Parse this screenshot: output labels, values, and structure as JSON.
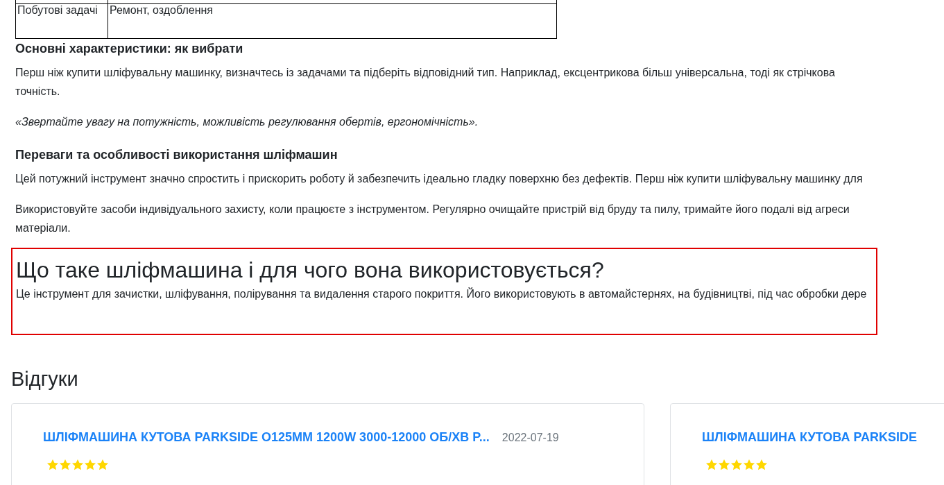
{
  "table": {
    "rows": [
      {
        "cells": [
          "",
          ""
        ]
      },
      {
        "cells": [
          "Побутові задачі",
          "Ремонт, оздоблення"
        ]
      }
    ]
  },
  "sections": [
    {
      "heading": "Основні характеристики: як вибрати",
      "paragraphs": [
        {
          "kind": "plain",
          "lines": [
            "Перш ніж купити шліфувальну машинку, визначтесь із задачами та підберіть відповідний тип. Наприклад, ексцентрикова більш універсальна, тоді як стрічкова",
            "точність."
          ]
        },
        {
          "kind": "quote",
          "lines": [
            "«Звертайте увагу на потужність, можливість регулювання обертів, ергономічність»."
          ]
        }
      ]
    },
    {
      "heading": "Переваги та особливості використання шліфмашин",
      "paragraphs": [
        {
          "kind": "plain",
          "lines": [
            "Цей потужний інструмент значно спростить і прискорить роботу й забезпечить ідеально гладку поверхню без дефектів. Перш ніж купити шліфувальну машинку для"
          ]
        },
        {
          "kind": "plain",
          "lines": [
            "Використовуйте засоби індивідуального захисту, коли працюєте з інструментом. Регулярно очищайте пристрій від бруду та пилу, тримайте його подалі від агреси",
            "матеріали."
          ]
        }
      ]
    }
  ],
  "highlight": {
    "heading": "Що таке шліфмашина і для чого вона використовується?",
    "text": "Це інструмент для зачистки, шліфування, полірування та видалення старого покриття. Його використовують в автомайстернях, на будівництві, під час обробки дере"
  },
  "reviews": {
    "heading": "Відгуки",
    "items": [
      {
        "title": "ШЛІФМАШИНА КУТОВА PARKSIDE O125MM 1200W 3000-12000 ОБ/ХВ P...",
        "date": "2022-07-19",
        "stars": 5
      },
      {
        "title": "ШЛІФМАШИНА КУТОВА PARKSIDE",
        "stars": 5
      }
    ]
  }
}
